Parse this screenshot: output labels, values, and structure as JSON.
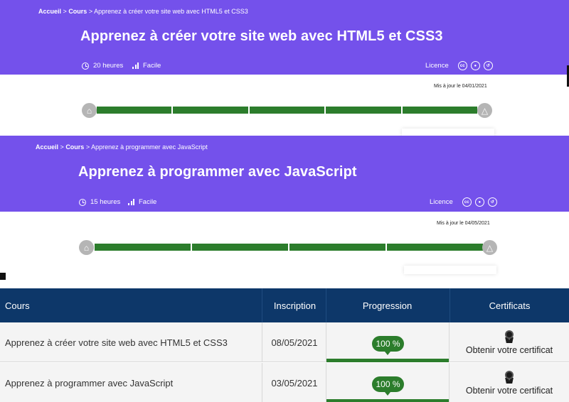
{
  "courses": [
    {
      "breadcrumb": {
        "home": "Accueil",
        "sep": ">",
        "section": "Cours",
        "current": "Apprenez à créer votre site web avec HTML5 et CSS3"
      },
      "title": "Apprenez à créer votre site web avec HTML5 et CSS3",
      "duration": "20 heures",
      "level": "Facile",
      "licence_label": "Licence",
      "licence_icons": [
        "cc-icon",
        "by-icon",
        "sa-icon"
      ],
      "updated": "Mis à jour le 04/01/2021",
      "progress_segments": 5,
      "progress": 1.0
    },
    {
      "breadcrumb": {
        "home": "Accueil",
        "sep": ">",
        "section": "Cours",
        "current": "Apprenez à programmer avec JavaScript"
      },
      "title": "Apprenez à programmer avec JavaScript",
      "duration": "15 heures",
      "level": "Facile",
      "licence_label": "Licence",
      "licence_icons": [
        "cc-icon",
        "by-icon",
        "sa-icon"
      ],
      "updated": "Mis à jour le 04/05/2021",
      "progress_segments": 4,
      "progress": 1.0
    }
  ],
  "table": {
    "headers": [
      "Cours",
      "Inscription",
      "Progression",
      "Certificats"
    ],
    "rows": [
      {
        "course": "Apprenez à créer votre site web avec HTML5 et CSS3",
        "date": "08/05/2021",
        "progress": "100 %",
        "progress_value": 1.0,
        "certificate": "Obtenir votre certificat"
      },
      {
        "course": "Apprenez à programmer avec JavaScript",
        "date": "03/05/2021",
        "progress": "100 %",
        "progress_value": 1.0,
        "certificate": "Obtenir votre certificat"
      }
    ]
  },
  "colors": {
    "banner": "#7451eb",
    "progress": "#2c7d2c",
    "table_header": "#0d3769",
    "row_bg": "#f4f4f4"
  }
}
